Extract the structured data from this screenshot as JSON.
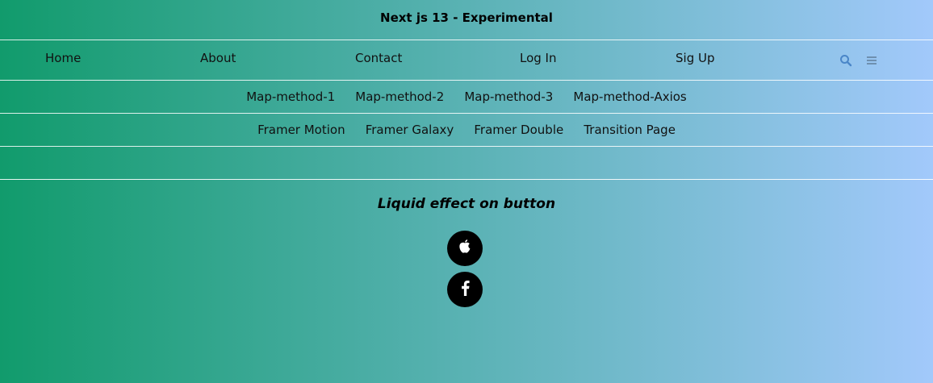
{
  "header": {
    "title": "Next js 13 - Experimental"
  },
  "main_nav": {
    "items": [
      {
        "label": "Home"
      },
      {
        "label": "About"
      },
      {
        "label": "Contact"
      },
      {
        "label": "Log In"
      },
      {
        "label": "Sig Up"
      }
    ],
    "icons": [
      "search-icon",
      "menu-icon"
    ],
    "icon_color": "#4a86c8"
  },
  "map_nav": {
    "items": [
      {
        "label": "Map-method-1"
      },
      {
        "label": "Map-method-2"
      },
      {
        "label": "Map-method-3"
      },
      {
        "label": "Map-method-Axios"
      }
    ]
  },
  "framer_nav": {
    "items": [
      {
        "label": "Framer Motion"
      },
      {
        "label": "Framer Galaxy"
      },
      {
        "label": "Framer Double"
      },
      {
        "label": "Transition Page"
      }
    ]
  },
  "content": {
    "heading": "Liquid effect on button",
    "buttons": [
      "apple-icon",
      "facebook-icon"
    ]
  },
  "colors": {
    "gradient_start": "#119b6c",
    "gradient_end": "#a2c9fb",
    "button_bg": "#000000"
  }
}
